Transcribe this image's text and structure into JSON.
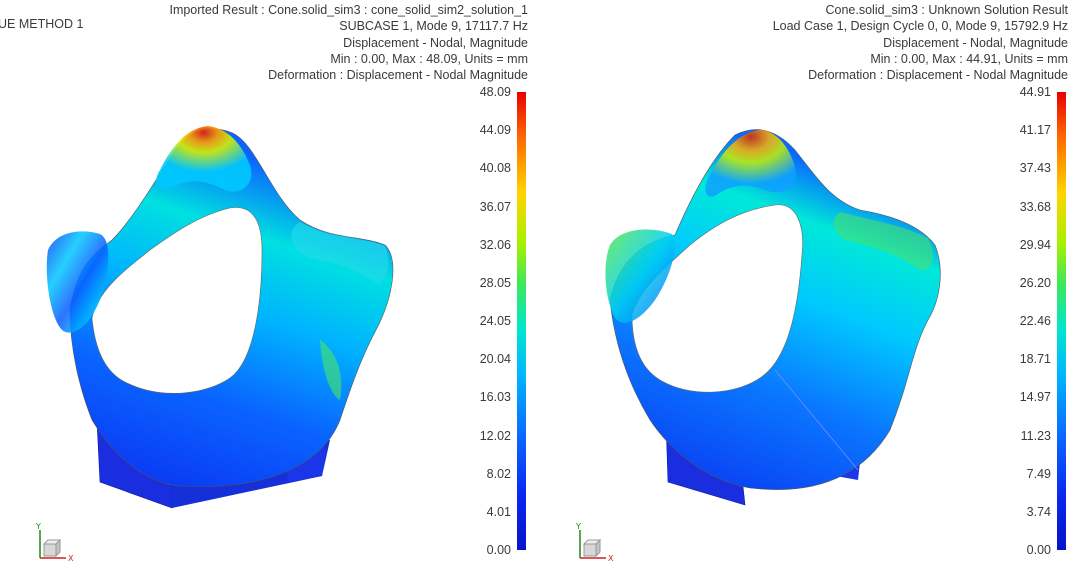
{
  "left_view": {
    "method_label": "UE METHOD 1",
    "header_lines": [
      "Imported Result : Cone.solid_sim3 : cone_solid_sim2_solution_1",
      "SUBCASE 1, Mode 9, 17117.7 Hz",
      "Displacement - Nodal, Magnitude",
      "Min : 0.00, Max : 48.09, Units = mm",
      "Deformation : Displacement - Nodal Magnitude"
    ],
    "legend_ticks": [
      "48.09",
      "44.09",
      "40.08",
      "36.07",
      "32.06",
      "28.05",
      "24.05",
      "20.04",
      "16.03",
      "12.02",
      "8.02",
      "4.01",
      "0.00"
    ],
    "triad": {
      "y_label": "Y",
      "x_label": "X"
    }
  },
  "right_view": {
    "header_lines": [
      "Cone.solid_sim3 : Unknown Solution Result",
      "Load Case 1, Design Cycle 0, 0, Mode 9, 15792.9 Hz",
      "Displacement - Nodal, Magnitude",
      "Min : 0.00, Max : 44.91, Units = mm",
      "Deformation : Displacement - Nodal Magnitude"
    ],
    "legend_ticks": [
      "44.91",
      "41.17",
      "37.43",
      "33.68",
      "29.94",
      "26.20",
      "22.46",
      "18.71",
      "14.97",
      "11.23",
      "7.49",
      "3.74",
      "0.00"
    ],
    "triad": {
      "y_label": "Y",
      "x_label": "X"
    }
  },
  "colors": {
    "scale": [
      "#e80000",
      "#ff6a00",
      "#ffd400",
      "#a8f000",
      "#3be85b",
      "#00e6d0",
      "#00b4ff",
      "#0a64ff",
      "#0a28f0",
      "#0514c8"
    ],
    "label_text": "#3a3a3a",
    "base_block": "#1a2ee0"
  }
}
